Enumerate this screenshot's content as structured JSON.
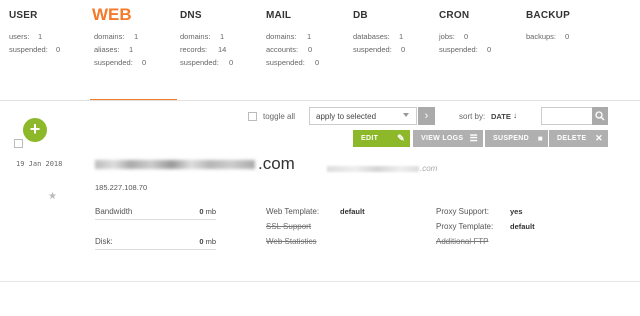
{
  "tabs": [
    {
      "title": "USER",
      "stats": [
        {
          "k": "users:",
          "v": "1"
        },
        {
          "k": "suspended:",
          "v": "0"
        }
      ]
    },
    {
      "title": "WEB",
      "stats": [
        {
          "k": "domains:",
          "v": "1"
        },
        {
          "k": "aliases:",
          "v": "1"
        },
        {
          "k": "suspended:",
          "v": "0"
        }
      ]
    },
    {
      "title": "DNS",
      "stats": [
        {
          "k": "domains:",
          "v": "1"
        },
        {
          "k": "records:",
          "v": "14"
        },
        {
          "k": "suspended:",
          "v": "0"
        }
      ]
    },
    {
      "title": "MAIL",
      "stats": [
        {
          "k": "domains:",
          "v": "1"
        },
        {
          "k": "accounts:",
          "v": "0"
        },
        {
          "k": "suspended:",
          "v": "0"
        }
      ]
    },
    {
      "title": "DB",
      "stats": [
        {
          "k": "databases:",
          "v": "1"
        },
        {
          "k": "suspended:",
          "v": "0"
        }
      ]
    },
    {
      "title": "CRON",
      "stats": [
        {
          "k": "jobs:",
          "v": "0"
        },
        {
          "k": "suspended:",
          "v": "0"
        }
      ]
    },
    {
      "title": "BACKUP",
      "stats": [
        {
          "k": "backups:",
          "v": "0"
        }
      ]
    }
  ],
  "active_tab": "WEB",
  "toolbar": {
    "add_label": "+",
    "toggle_all_label": "toggle all",
    "bulk_action_value": "apply to selected",
    "sort_by_label": "sort by:",
    "sort_by_value": "DATE",
    "sort_direction_glyph": "↓",
    "search_value": ""
  },
  "row": {
    "date": "19 Jan 2018",
    "domain_suffix": ".com",
    "alias_suffix": ".com",
    "ip": "185.227.108.70",
    "actions": {
      "edit": "EDIT",
      "logs": "VIEW LOGS",
      "suspend": "SUSPEND",
      "delete": "DELETE"
    },
    "bandwidth_label": "Bandwidth",
    "bandwidth_value": "0",
    "bandwidth_unit": "mb",
    "disk_label": "Disk:",
    "disk_value": "0",
    "disk_unit": "mb",
    "web_template_label": "Web Template:",
    "web_template_value": "default",
    "ssl_support_label": "SSL Support",
    "web_statistics_label": "Web Statistics",
    "proxy_support_label": "Proxy Support:",
    "proxy_support_value": "yes",
    "proxy_template_label": "Proxy Template:",
    "proxy_template_value": "default",
    "additional_ftp_label": "Additional FTP"
  },
  "colors": {
    "accent": "#f47a2a",
    "edit_green": "#8cb82a",
    "action_gray": "#b0b0b0"
  }
}
